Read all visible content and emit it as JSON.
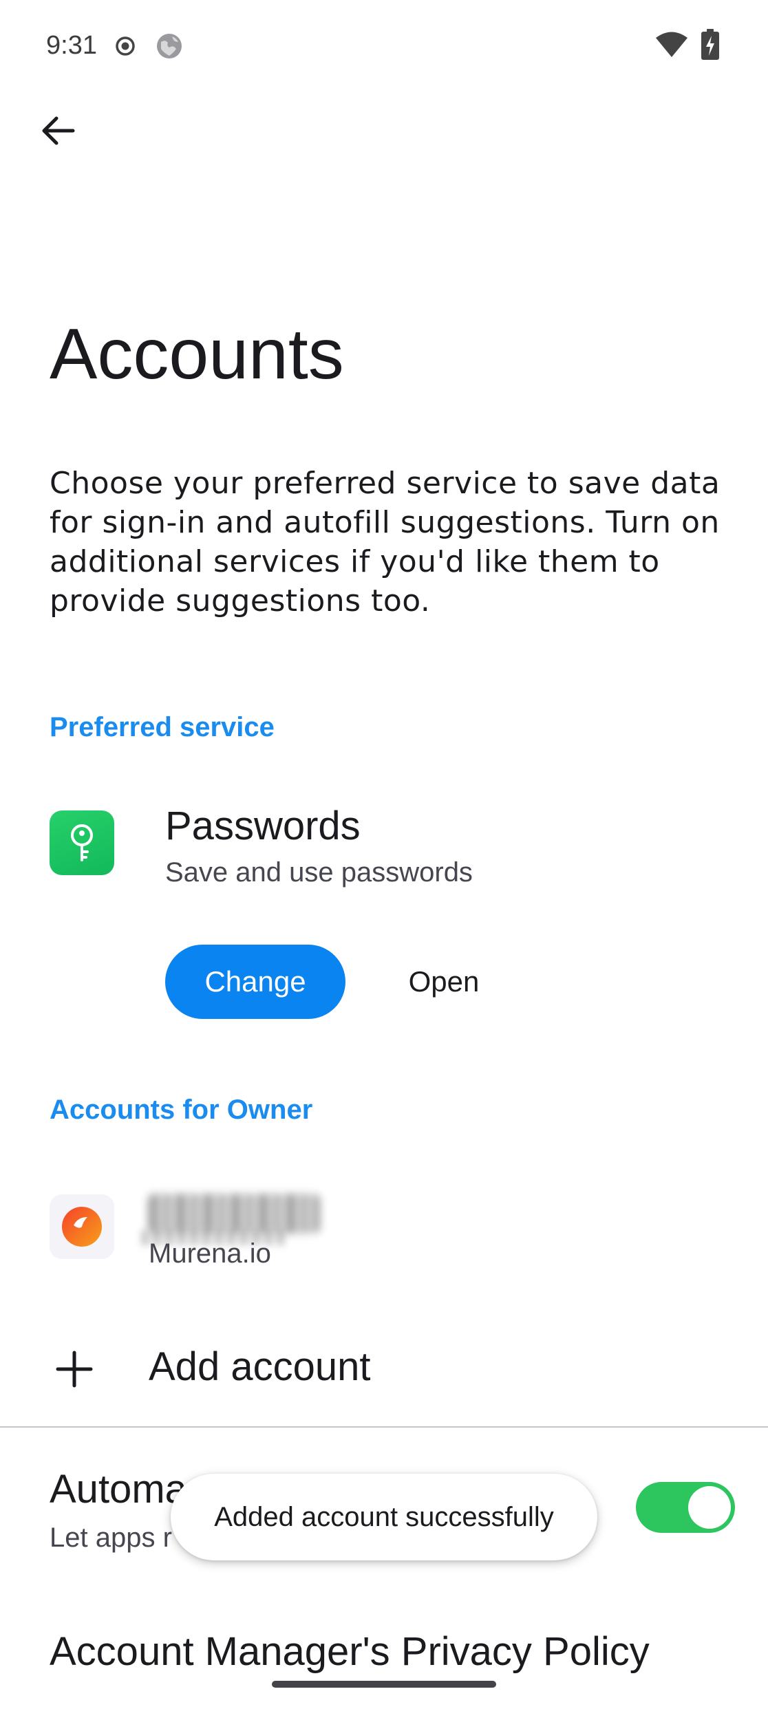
{
  "status_bar": {
    "time": "9:31",
    "icons": [
      "record-dot-icon",
      "globe-icon",
      "wifi-icon",
      "battery-charging-icon"
    ]
  },
  "header": {
    "back_icon": "back-arrow-icon"
  },
  "page": {
    "title": "Accounts",
    "description": "Choose your preferred service to save data for sign-in and autofill suggestions. Turn on additional services if you'd like them to provide suggestions too."
  },
  "preferred_service": {
    "header": "Preferred service",
    "item": {
      "icon": "passwords-key-icon",
      "title": "Passwords",
      "subtitle": "Save and use passwords"
    },
    "change_label": "Change",
    "open_label": "Open"
  },
  "accounts": {
    "header": "Accounts for Owner",
    "items": [
      {
        "icon": "murena-icon",
        "type": "Murena.io"
      }
    ],
    "add_label": "Add account"
  },
  "auto_sync": {
    "title_visible": "Automa",
    "subtitle_visible": "Let apps r",
    "enabled": true
  },
  "toast": {
    "message": "Added account successfully"
  },
  "privacy_policy": {
    "title": "Account Manager's Privacy Policy"
  },
  "colors": {
    "accent": "#0a84f0",
    "section_header": "#1a8cf0",
    "toggle_on": "#2dc55e",
    "passwords_icon_bg": "#13b95a"
  }
}
